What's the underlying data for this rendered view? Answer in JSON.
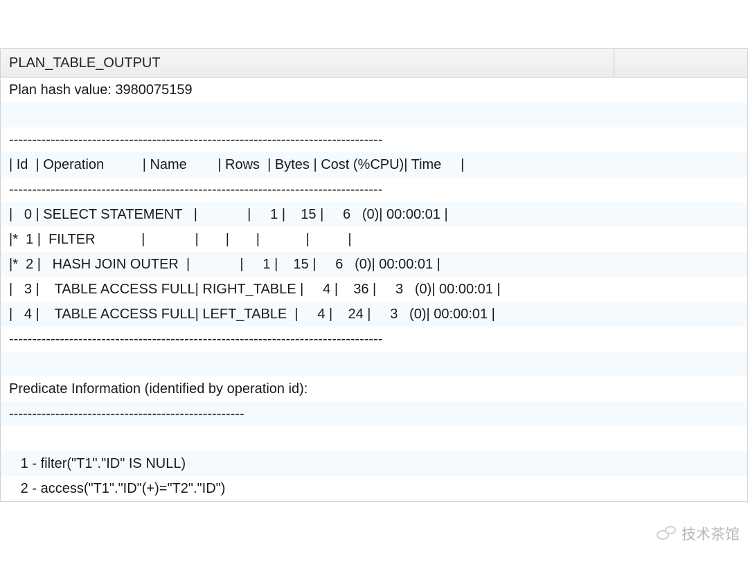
{
  "header": {
    "column_title": "PLAN_TABLE_OUTPUT"
  },
  "lines": [
    "Plan hash value: 3980075159",
    "",
    "---------------------------------------------------------------------------------",
    "| Id  | Operation          | Name        | Rows  | Bytes | Cost (%CPU)| Time     |",
    "---------------------------------------------------------------------------------",
    "|   0 | SELECT STATEMENT   |             |     1 |    15 |     6   (0)| 00:00:01 |",
    "|*  1 |  FILTER            |             |       |       |            |          |",
    "|*  2 |   HASH JOIN OUTER  |             |     1 |    15 |     6   (0)| 00:00:01 |",
    "|   3 |    TABLE ACCESS FULL| RIGHT_TABLE |     4 |    36 |     3   (0)| 00:00:01 |",
    "|   4 |    TABLE ACCESS FULL| LEFT_TABLE  |     4 |    24 |     3   (0)| 00:00:01 |",
    "---------------------------------------------------------------------------------",
    "",
    "Predicate Information (identified by operation id):",
    "---------------------------------------------------",
    "",
    "   1 - filter(\"T1\".\"ID\" IS NULL)",
    "   2 - access(\"T1\".\"ID\"(+)=\"T2\".\"ID\")"
  ],
  "watermark": {
    "text": "技术茶馆"
  },
  "chart_data": {
    "type": "table",
    "title": "PLAN_TABLE_OUTPUT",
    "plan_hash_value": 3980075159,
    "columns": [
      "Id",
      "Operation",
      "Name",
      "Rows",
      "Bytes",
      "Cost (%CPU)",
      "Time"
    ],
    "rows": [
      {
        "id": 0,
        "marker": "",
        "operation": "SELECT STATEMENT",
        "name": "",
        "rows": 1,
        "bytes": 15,
        "cost": 6,
        "cpu_pct": 0,
        "time": "00:00:01"
      },
      {
        "id": 1,
        "marker": "*",
        "operation": "FILTER",
        "name": "",
        "rows": null,
        "bytes": null,
        "cost": null,
        "cpu_pct": null,
        "time": ""
      },
      {
        "id": 2,
        "marker": "*",
        "operation": "HASH JOIN OUTER",
        "name": "",
        "rows": 1,
        "bytes": 15,
        "cost": 6,
        "cpu_pct": 0,
        "time": "00:00:01"
      },
      {
        "id": 3,
        "marker": "",
        "operation": "TABLE ACCESS FULL",
        "name": "RIGHT_TABLE",
        "rows": 4,
        "bytes": 36,
        "cost": 3,
        "cpu_pct": 0,
        "time": "00:00:01"
      },
      {
        "id": 4,
        "marker": "",
        "operation": "TABLE ACCESS FULL",
        "name": "LEFT_TABLE",
        "rows": 4,
        "bytes": 24,
        "cost": 3,
        "cpu_pct": 0,
        "time": "00:00:01"
      }
    ],
    "predicate_information": [
      "1 - filter(\"T1\".\"ID\" IS NULL)",
      "2 - access(\"T1\".\"ID\"(+)=\"T2\".\"ID\")"
    ]
  }
}
